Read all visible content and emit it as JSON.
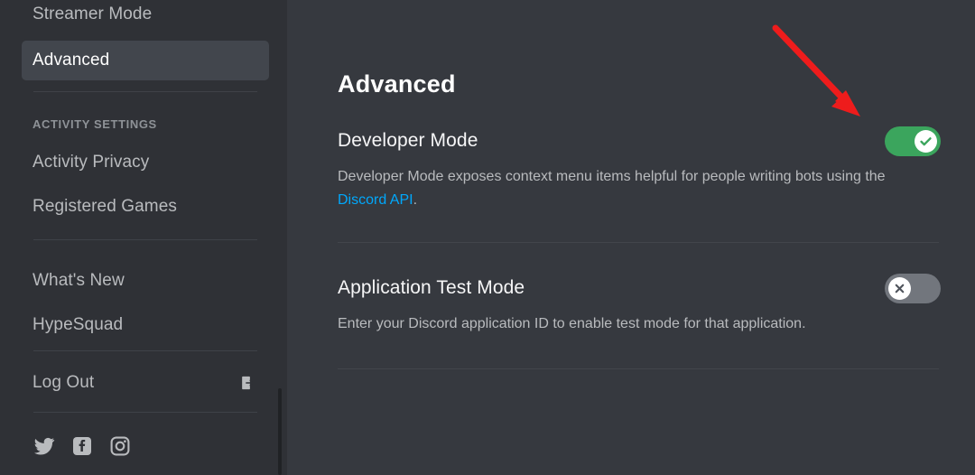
{
  "colors": {
    "sidebar_bg": "#2f3136",
    "main_bg": "#36393f",
    "active_item_bg": "#42464d",
    "toggle_on": "#3ba55d",
    "toggle_off": "#72767d",
    "link": "#00a8fc",
    "annotation_arrow": "#ee1c1c"
  },
  "sidebar": {
    "items": [
      {
        "label": "Streamer Mode",
        "active": false,
        "icon": null
      },
      {
        "label": "Advanced",
        "active": true,
        "icon": null
      }
    ],
    "section_header": "ACTIVITY SETTINGS",
    "activity_items": [
      {
        "label": "Activity Privacy",
        "active": false
      },
      {
        "label": "Registered Games",
        "active": false
      }
    ],
    "info_items": [
      {
        "label": "What's New",
        "active": false
      },
      {
        "label": "HypeSquad",
        "active": false
      }
    ],
    "logout": {
      "label": "Log Out",
      "icon": "logout-arrow-icon"
    },
    "social": [
      {
        "name": "twitter-icon"
      },
      {
        "name": "facebook-icon"
      },
      {
        "name": "instagram-icon"
      }
    ]
  },
  "main": {
    "title": "Advanced",
    "settings": [
      {
        "title": "Developer Mode",
        "desc_before": "Developer Mode exposes context menu items helpful for people writing bots using the ",
        "link_text": "Discord API",
        "desc_after": ".",
        "toggle_state": "on",
        "toggle_icon": "check-icon"
      },
      {
        "title": "Application Test Mode",
        "desc_before": "Enter your Discord application ID to enable test mode for that application.",
        "link_text": "",
        "desc_after": "",
        "toggle_state": "off",
        "toggle_icon": "x-icon"
      }
    ]
  },
  "annotation": {
    "type": "red-arrow",
    "points_at": "developer-mode-toggle"
  }
}
